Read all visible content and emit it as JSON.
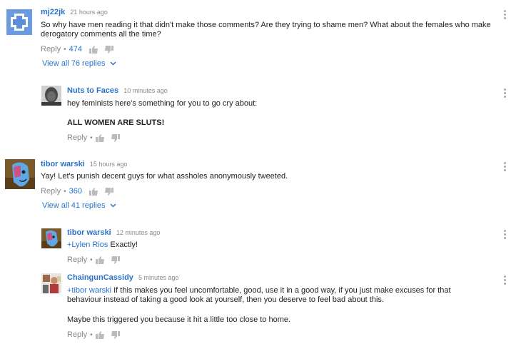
{
  "comments": [
    {
      "author": "mj22jk",
      "time": "21 hours ago",
      "text": "So why have men reading it that didn't make those comments?  Are they trying to shame men? What about the females who make derogatory comments all the time?",
      "reply": "Reply",
      "likes": "474",
      "view_all": "View all 76 replies"
    },
    {
      "author": "Nuts to Faces",
      "time": "10 minutes ago",
      "text_line1": "hey feminists here's something for you to go cry about:",
      "text_bold": "ALL WOMEN ARE SLUTS!",
      "reply": "Reply"
    },
    {
      "author": "tibor warski",
      "time": "15 hours ago",
      "text": "Yay! Let's punish decent guys for what assholes anonymously tweeted.",
      "reply": "Reply",
      "likes": "360",
      "view_all": "View all 41 replies"
    },
    {
      "author": "tibor warski",
      "time": "12 minutes ago",
      "mention": "+Lylen Rios",
      "text": " Exactly!",
      "reply": "Reply"
    },
    {
      "author": "ChaingunCassidy",
      "time": "5 minutes ago",
      "mention": "+tibor warski",
      "text": " If this makes you feel uncomfortable, good, use it in a good way, if you just make excuses for that behaviour instead of taking a good look at yourself, then you deserve to feel bad about this.",
      "text2": "Maybe this triggered you because it hit a little too close to home.",
      "reply": "Reply"
    }
  ],
  "dot": "•",
  "colors": {
    "link": "#2a73c9",
    "muted": "#888888"
  }
}
